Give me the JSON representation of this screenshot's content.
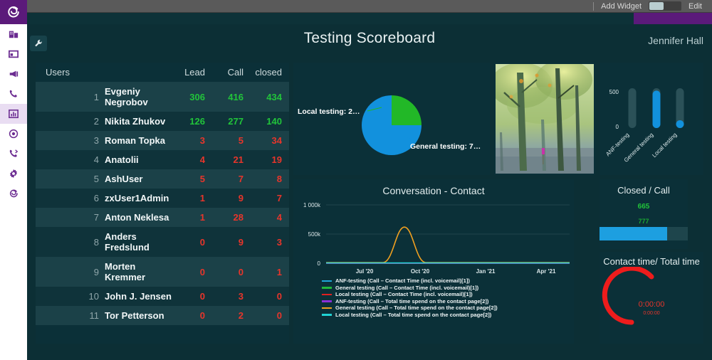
{
  "topbar": {
    "add_widget_label": "Add Widget",
    "edit_label": "Edit",
    "toggle_state": "off"
  },
  "sidebar": {
    "logo": "company-logo",
    "items": [
      {
        "name": "sidebar-item-organization",
        "icon": "building-icon",
        "active": false
      },
      {
        "name": "sidebar-item-dashboard",
        "icon": "window-icon",
        "active": false
      },
      {
        "name": "sidebar-item-campaign",
        "icon": "megaphone-icon",
        "active": false
      },
      {
        "name": "sidebar-item-calls",
        "icon": "phone-icon",
        "active": false
      },
      {
        "name": "sidebar-item-reports",
        "icon": "bar-chart-icon",
        "active": true
      },
      {
        "name": "sidebar-item-target",
        "icon": "target-icon",
        "active": false
      },
      {
        "name": "sidebar-item-contacts",
        "icon": "phone-forward-icon",
        "active": false
      },
      {
        "name": "sidebar-item-settings",
        "icon": "gear-icon",
        "active": false
      },
      {
        "name": "sidebar-item-help",
        "icon": "logo-mark-icon",
        "active": false
      }
    ]
  },
  "header": {
    "title": "Testing Scoreboard",
    "user": "Jennifer Hall",
    "tools_icon": "wrench-icon"
  },
  "table": {
    "columns": [
      "Users",
      "Lead",
      "Call",
      "closed"
    ],
    "rows": [
      {
        "idx": "1",
        "name": "Evgeniy Negrobov",
        "lead": "306",
        "call": "416",
        "closed": "434",
        "tone": "pos"
      },
      {
        "idx": "2",
        "name": "Nikita Zhukov",
        "lead": "126",
        "call": "277",
        "closed": "140",
        "tone": "pos"
      },
      {
        "idx": "3",
        "name": "Roman Topka",
        "lead": "3",
        "call": "5",
        "closed": "34",
        "tone": "neg"
      },
      {
        "idx": "4",
        "name": "Anatolii",
        "lead": "4",
        "call": "21",
        "closed": "19",
        "tone": "neg"
      },
      {
        "idx": "5",
        "name": "AshUser",
        "lead": "5",
        "call": "7",
        "closed": "8",
        "tone": "neg"
      },
      {
        "idx": "6",
        "name": "zxUser1Admin",
        "lead": "1",
        "call": "9",
        "closed": "7",
        "tone": "neg"
      },
      {
        "idx": "7",
        "name": "Anton Neklesa",
        "lead": "1",
        "call": "28",
        "closed": "4",
        "tone": "neg"
      },
      {
        "idx": "8",
        "name": "Anders Fredslund",
        "lead": "0",
        "call": "9",
        "closed": "3",
        "tone": "neg"
      },
      {
        "idx": "9",
        "name": "Morten Kremmer",
        "lead": "0",
        "call": "0",
        "closed": "1",
        "tone": "neg"
      },
      {
        "idx": "10",
        "name": "John J. Jensen",
        "lead": "0",
        "call": "3",
        "closed": "0",
        "tone": "neg"
      },
      {
        "idx": "11",
        "name": "Tor Petterson",
        "lead": "0",
        "call": "2",
        "closed": "0",
        "tone": "neg"
      }
    ]
  },
  "widgets": {
    "image": {
      "caption": "forest-trees-photo"
    },
    "closed_call": {
      "title": "Closed / Call",
      "value": "665",
      "value_secondary": "777",
      "progress_percent": 77
    },
    "gauge": {
      "title": "Contact time/ Total time",
      "value": "0:00:00",
      "value_secondary": "0:00:00",
      "arc_color": "#ee1c1c"
    }
  },
  "chart_data": [
    {
      "id": "testing-pie",
      "type": "pie",
      "title": "",
      "labels": [
        "Local testing: 2…",
        "General testing: 7…"
      ],
      "values": [
        25,
        75
      ],
      "colors": [
        "#22b827",
        "#1291dd"
      ],
      "legend": "labels-outside"
    },
    {
      "id": "testing-bullets",
      "type": "bar",
      "title": "",
      "categories": [
        "ANF-testing",
        "General testing",
        "Local testing"
      ],
      "values": [
        0,
        470,
        60
      ],
      "ylim": [
        0,
        500
      ],
      "ytick_labels": [
        "0",
        "500"
      ],
      "bar_color": "#1291dd",
      "track_color": "#2b5158",
      "orientation": "vertical",
      "grid": false
    },
    {
      "id": "conversation-contact",
      "type": "line",
      "title": "Conversation - Contact",
      "xlabel": "",
      "ylabel": "",
      "x": [
        "Jul '20",
        "Oct '20",
        "Jan '21",
        "Apr '21"
      ],
      "ytick_labels": [
        "0",
        "500k",
        "1 000k"
      ],
      "ylim": [
        0,
        1000000
      ],
      "grid": true,
      "legend_position": "bottom",
      "series": [
        {
          "name": "ANF-testing (Call – Contact Time (incl. voicemail)[1])",
          "color": "#1fa8d8",
          "values": [
            0,
            0,
            0,
            0
          ]
        },
        {
          "name": "General testing (Call – Contact Time (incl. voicemail)[1])",
          "color": "#21b93c",
          "values": [
            0,
            0,
            0,
            0
          ]
        },
        {
          "name": "Local testing (Call – Contact Time (incl. voicemail)[1])",
          "color": "#e02020",
          "values": [
            0,
            0,
            0,
            0
          ]
        },
        {
          "name": "ANF-testing (Call – Total time spend on the contact page[2])",
          "color": "#8b2fd6",
          "values": [
            0,
            0,
            0,
            0
          ]
        },
        {
          "name": "General testing (Call – Total time spend on the contact page[2])",
          "color": "#f0a020",
          "values": [
            0,
            620000,
            0,
            0
          ]
        },
        {
          "name": "Local testing (Call – Total time spend on the contact page[2])",
          "color": "#1fd4d4",
          "values": [
            5000,
            5000,
            5000,
            5000
          ]
        }
      ]
    }
  ]
}
